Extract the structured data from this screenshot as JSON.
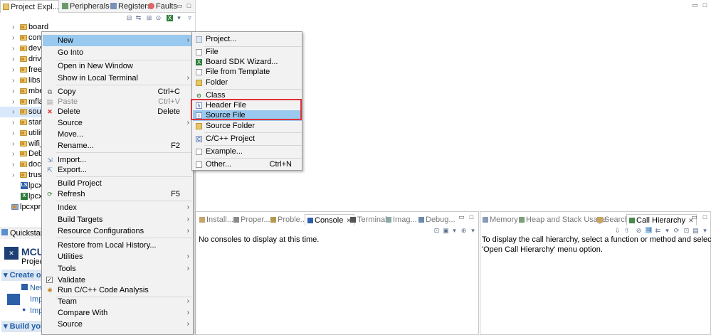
{
  "left_panel": {
    "tabs": [
      {
        "label": "Project Expl..."
      },
      {
        "label": "Peripherals+"
      },
      {
        "label": "Registers"
      },
      {
        "label": "Faults"
      }
    ],
    "tree": [
      {
        "label": "board"
      },
      {
        "label": "com"
      },
      {
        "label": "devi"
      },
      {
        "label": "drive"
      },
      {
        "label": "freer"
      },
      {
        "label": "libs"
      },
      {
        "label": "mbe"
      },
      {
        "label": "mfla"
      },
      {
        "label": "sour"
      },
      {
        "label": "start"
      },
      {
        "label": "utilit"
      },
      {
        "label": "wifi_"
      },
      {
        "label": "Deb"
      },
      {
        "label": "doc"
      },
      {
        "label": "trust"
      },
      {
        "label": "lpcx"
      },
      {
        "label": "lpcx"
      },
      {
        "label": "lpcxpre"
      }
    ]
  },
  "quickstart": {
    "tab": "Quickstart",
    "title": "MCU",
    "subtitle": "Project",
    "section_create": "Create or",
    "link1": "New",
    "link2": "Imp",
    "link3": "Imp",
    "section_build": "Build you"
  },
  "context_menu": {
    "items": {
      "new": "New",
      "go_into": "Go Into",
      "open_new_window": "Open in New Window",
      "show_terminal": "Show in Local Terminal",
      "copy": "Copy",
      "copy_sc": "Ctrl+C",
      "paste": "Paste",
      "paste_sc": "Ctrl+V",
      "delete": "Delete",
      "delete_sc": "Delete",
      "source1": "Source",
      "move": "Move...",
      "rename": "Rename...",
      "rename_sc": "F2",
      "import": "Import...",
      "export": "Export...",
      "build_project": "Build Project",
      "refresh": "Refresh",
      "refresh_sc": "F5",
      "index": "Index",
      "build_targets": "Build Targets",
      "resource_configs": "Resource Configurations",
      "restore_history": "Restore from Local History...",
      "utilities": "Utilities",
      "tools": "Tools",
      "validate": "Validate",
      "run_analysis": "Run C/C++ Code Analysis",
      "team": "Team",
      "compare_with": "Compare With",
      "source2": "Source"
    }
  },
  "submenu": {
    "project": "Project...",
    "file": "File",
    "board_sdk": "Board SDK Wizard...",
    "file_template": "File from Template",
    "folder": "Folder",
    "class": "Class",
    "header_file": "Header File",
    "source_file": "Source File",
    "source_folder": "Source Folder",
    "cpp_project": "C/C++ Project",
    "example": "Example...",
    "other": "Other...",
    "other_sc": "Ctrl+N"
  },
  "console_panel": {
    "tabs": [
      "Install...",
      "Proper...",
      "Proble...",
      "Console",
      "Terminal",
      "Imag...",
      "Debug..."
    ],
    "message": "No consoles to display at this time."
  },
  "hierarchy_panel": {
    "tabs": [
      "Memory",
      "Heap and Stack Usage",
      "Search",
      "Call Hierarchy"
    ],
    "message_line1": "To display the call hierarchy, select a function or method and select the",
    "message_line2": "'Open Call Hierarchy' menu option."
  },
  "colors": {
    "menu_highlight": "#99c9ef",
    "annotation_box": "#e0333b",
    "menu_bg": "#f2f2f2"
  }
}
